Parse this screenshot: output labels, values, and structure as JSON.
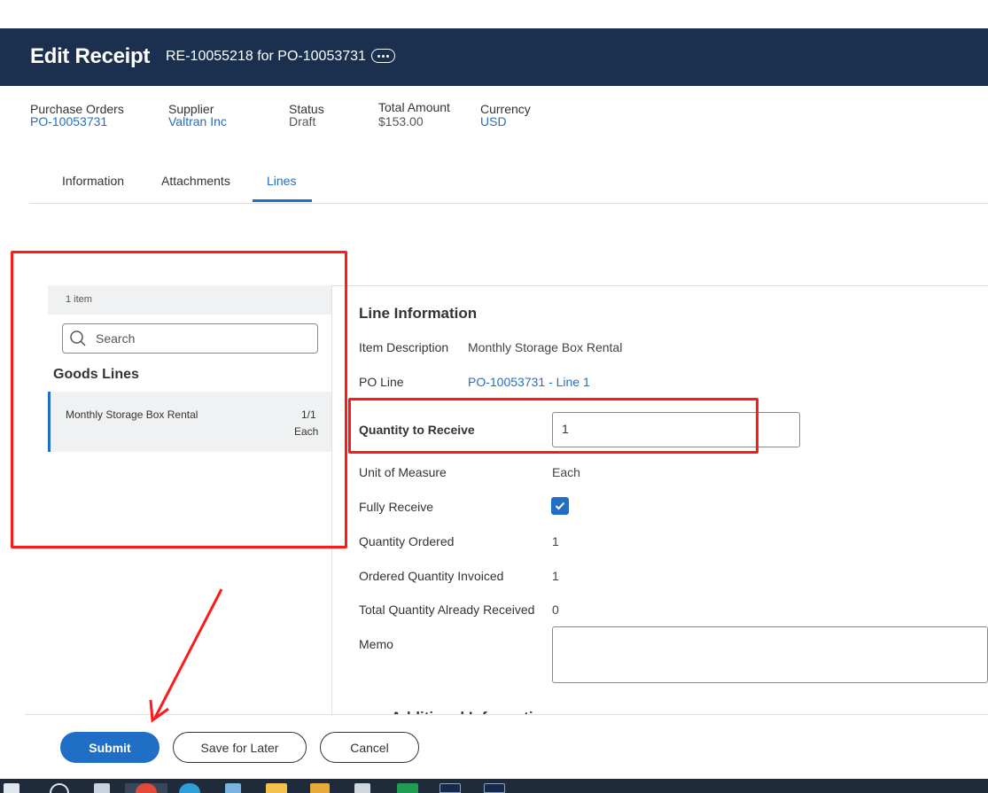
{
  "header": {
    "title": "Edit Receipt",
    "subtitle": "RE-10055218 for PO-10053731"
  },
  "summary": {
    "purchase_orders_label": "Purchase Orders",
    "purchase_orders_value": "PO-10053731",
    "supplier_label": "Supplier",
    "supplier_value": "Valtran Inc",
    "status_label": "Status",
    "status_value": "Draft",
    "total_amount_label": "Total Amount",
    "total_amount_value": "$153.00",
    "currency_label": "Currency",
    "currency_value": "USD"
  },
  "tabs": [
    {
      "label": "Information",
      "active": false
    },
    {
      "label": "Attachments",
      "active": false
    },
    {
      "label": "Lines",
      "active": true
    }
  ],
  "left_panel": {
    "item_count": "1 item",
    "search_placeholder": "Search",
    "section_title": "Goods Lines",
    "lines": [
      {
        "description": "Monthly Storage Box Rental",
        "fraction": "1/1",
        "unit": "Each"
      }
    ]
  },
  "line_info": {
    "title": "Line Information",
    "item_description_label": "Item Description",
    "item_description_value": "Monthly Storage Box Rental",
    "po_line_label": "PO Line",
    "po_line_value": "PO-10053731 - Line 1",
    "qty_to_receive_label": "Quantity to Receive",
    "qty_to_receive_value": "1",
    "uom_label": "Unit of Measure",
    "uom_value": "Each",
    "fully_receive_label": "Fully Receive",
    "fully_receive_checked": true,
    "qty_ordered_label": "Quantity Ordered",
    "qty_ordered_value": "1",
    "ordered_qty_invoiced_label": "Ordered Quantity Invoiced",
    "ordered_qty_invoiced_value": "1",
    "total_qty_received_label": "Total Quantity Already Received",
    "total_qty_received_value": "0",
    "memo_label": "Memo",
    "memo_value": "",
    "additional_info_title": "Additional Information"
  },
  "footer": {
    "submit_label": "Submit",
    "save_later_label": "Save for Later",
    "cancel_label": "Cancel"
  },
  "colors": {
    "header_bg": "#1b2f4f",
    "accent": "#1f6fc6",
    "annotation": "#ff1a1a"
  }
}
